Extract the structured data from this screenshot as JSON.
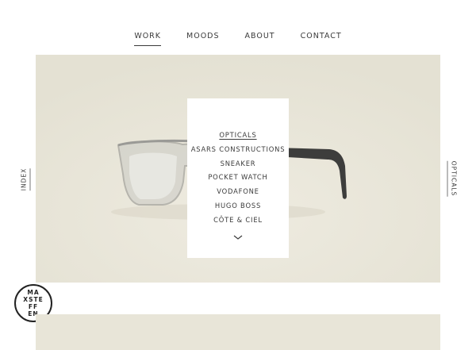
{
  "nav": {
    "items": [
      {
        "label": "WORK",
        "active": true
      },
      {
        "label": "MOODS",
        "active": false
      },
      {
        "label": "ABOUT",
        "active": false
      },
      {
        "label": "CONTACT",
        "active": false
      }
    ]
  },
  "menu": {
    "items": [
      {
        "label": "OPTICALS",
        "active": true
      },
      {
        "label": "ASARS CONSTRUCTIONS",
        "active": false
      },
      {
        "label": "SNEAKER",
        "active": false
      },
      {
        "label": "POCKET WATCH",
        "active": false
      },
      {
        "label": "VODAFONE",
        "active": false
      },
      {
        "label": "HUGO BOSS",
        "active": false
      },
      {
        "label": "CÔTE & CIEL",
        "active": false
      }
    ],
    "more_icon": "chevron-down-icon"
  },
  "side": {
    "left_label": "INDEX",
    "right_label": "OPTICALS"
  },
  "logo": {
    "lines": [
      "MA",
      "XSTE",
      "FF",
      "EN"
    ]
  },
  "colors": {
    "hero_bg": "#e8e5d8",
    "text": "#3a3a3a",
    "page_bg": "#ffffff"
  }
}
